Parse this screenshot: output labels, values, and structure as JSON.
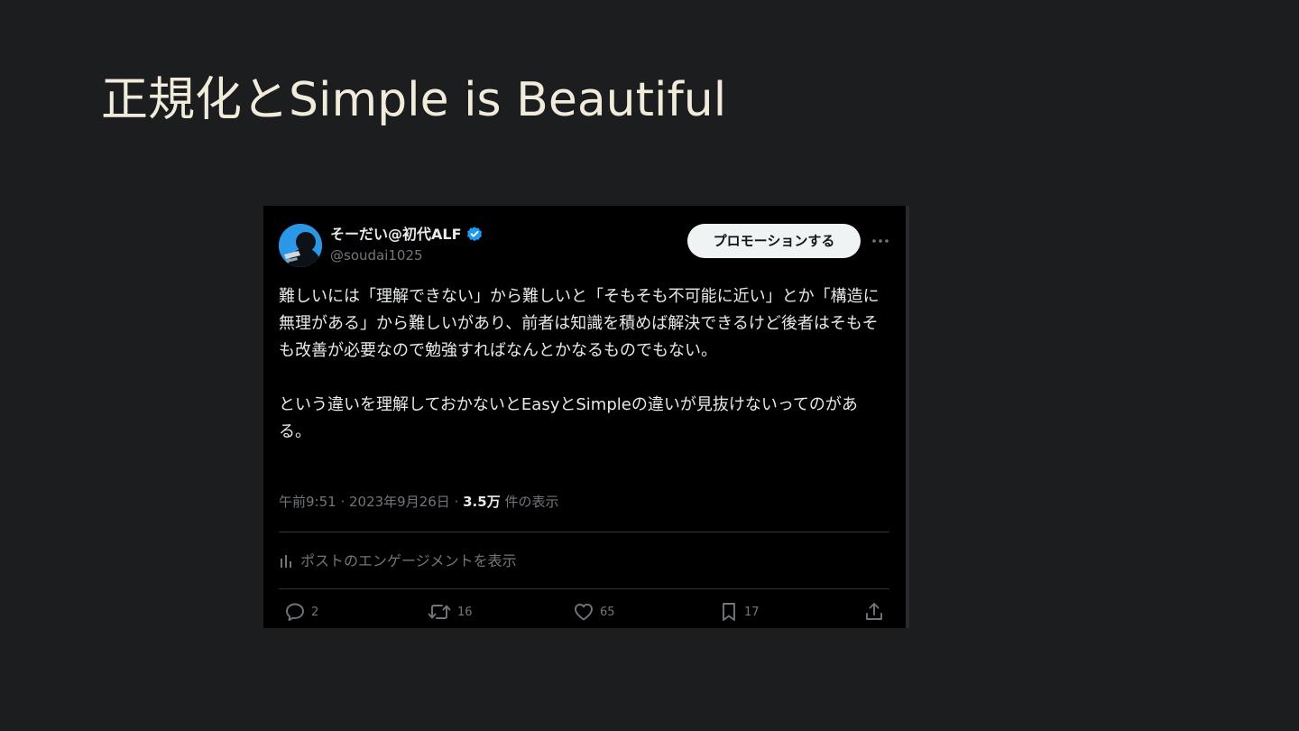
{
  "slide": {
    "title": "正規化とSimple is Beautiful"
  },
  "tweet": {
    "author": {
      "display_name": "そーだい@初代ALF",
      "handle": "@soudai1025",
      "verified": true
    },
    "promote_label": "プロモーションする",
    "more_icon": "more-horizontal-icon",
    "text": {
      "paragraph1": "難しいには「理解できない」から難しいと「そもそも不可能に近い」とか「構造に無理がある」から難しいがあり、前者は知識を積めば解決できるけど後者はそもそも改善が必要なので勉強すればなんとかなるものでもない。",
      "paragraph2": "という違いを理解しておかないとEasyとSimpleの違いが見抜けないってのがある。"
    },
    "meta": {
      "time": "午前9:51",
      "separator": " · ",
      "date": "2023年9月26日",
      "views_count": "3.5万",
      "views_label": " 件の表示"
    },
    "engagement_label": "ポストのエンゲージメントを表示",
    "actions": {
      "reply": {
        "icon": "reply-icon",
        "count": "2"
      },
      "repost": {
        "icon": "repost-icon",
        "count": "16"
      },
      "like": {
        "icon": "like-icon",
        "count": "65"
      },
      "bookmark": {
        "icon": "bookmark-icon",
        "count": "17"
      },
      "share": {
        "icon": "share-icon"
      }
    },
    "colors": {
      "background": "#000000",
      "text": "#e7e9ea",
      "secondary_text": "#71767b",
      "verified": "#1d9bf0",
      "button_bg": "#eff3f4"
    }
  }
}
